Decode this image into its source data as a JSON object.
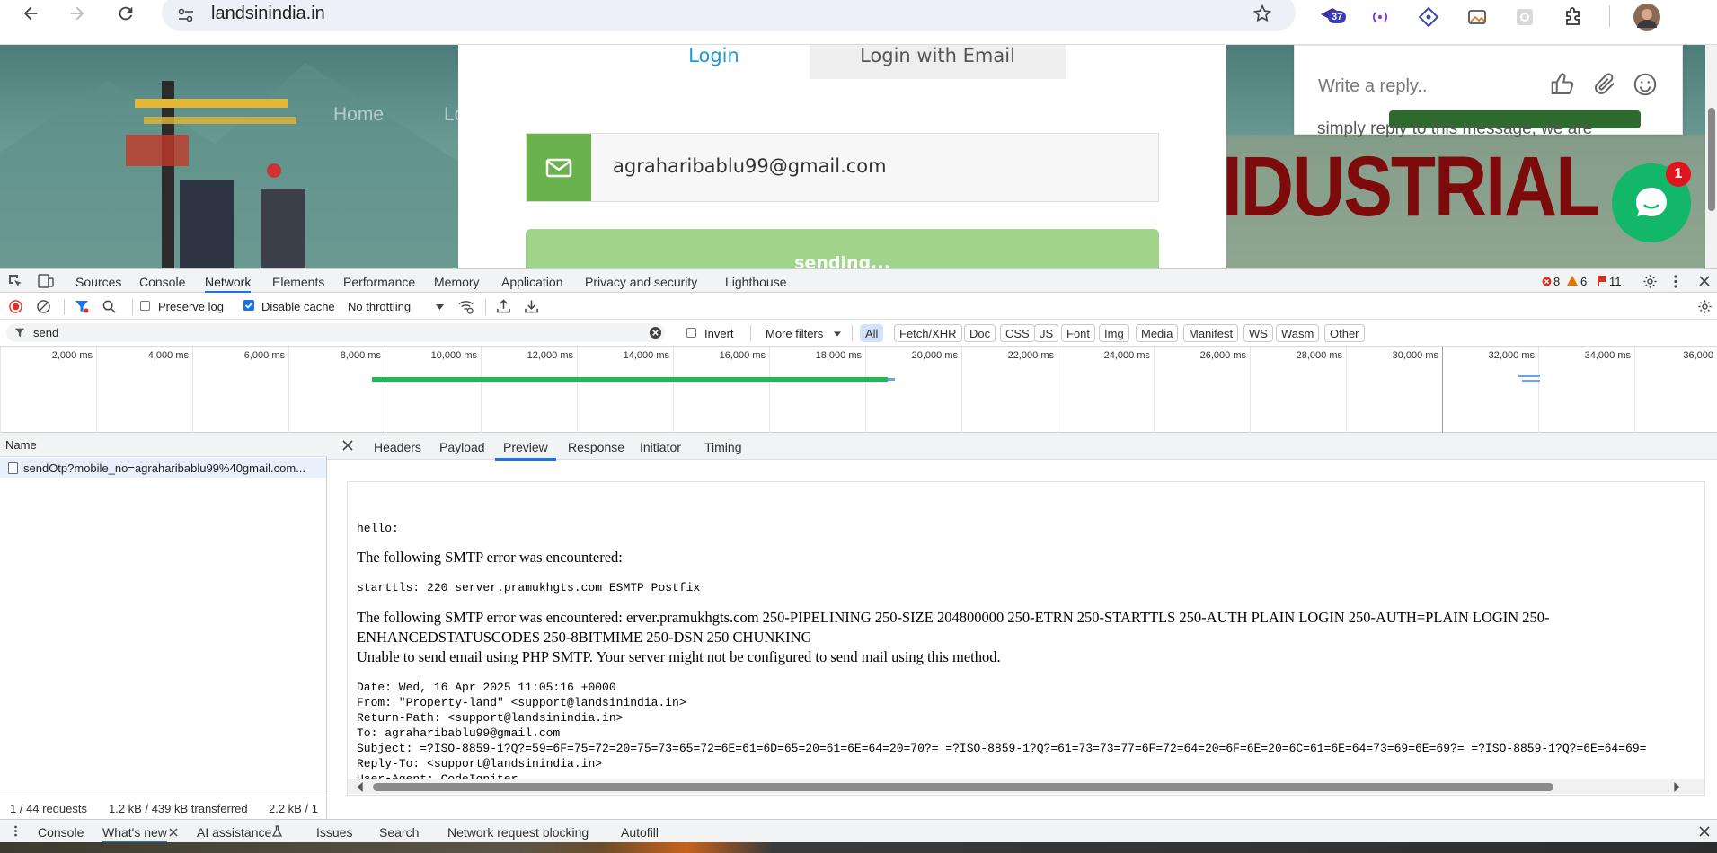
{
  "browser": {
    "url": "landsinindia.in",
    "extension_badge": "37"
  },
  "page": {
    "nav": {
      "home": "Home",
      "partial": "Lo"
    },
    "banner_text": "IDUSTRIAL",
    "login_tabs": [
      "Login",
      "Login with Email"
    ],
    "email_value": "agraharibablu99@gmail.com",
    "send_button": "sending...",
    "chat": {
      "placeholder": "Write a reply..",
      "teaser": "simply reply to this message, we are",
      "unread_count": "1"
    }
  },
  "devtools": {
    "tabs": [
      "Sources",
      "Console",
      "Network",
      "Elements",
      "Performance",
      "Memory",
      "Application",
      "Privacy and security",
      "Lighthouse"
    ],
    "active_tab": "Network",
    "counts": {
      "errors": "8",
      "warnings": "6",
      "issues": "11"
    },
    "network_bar": {
      "preserve_log": "Preserve log",
      "disable_cache": "Disable cache",
      "throttling": "No throttling"
    },
    "filter": {
      "value": "send",
      "invert": "Invert",
      "more_filters": "More filters",
      "chips": [
        "All",
        "Fetch/XHR",
        "Doc",
        "CSS",
        "JS",
        "Font",
        "Img",
        "Media",
        "Manifest",
        "WS",
        "Wasm",
        "Other"
      ]
    },
    "timeline_ticks": [
      "2,000 ms",
      "4,000 ms",
      "6,000 ms",
      "8,000 ms",
      "10,000 ms",
      "12,000 ms",
      "14,000 ms",
      "16,000 ms",
      "18,000 ms",
      "20,000 ms",
      "22,000 ms",
      "24,000 ms",
      "26,000 ms",
      "28,000 ms",
      "30,000 ms",
      "32,000 ms",
      "34,000 ms",
      "36,000"
    ],
    "name_header": "Name",
    "request_name": "sendOtp?mobile_no=agraharibablu99%40gmail.com...",
    "detail_tabs": [
      "Headers",
      "Payload",
      "Preview",
      "Response",
      "Initiator",
      "Timing"
    ],
    "active_detail_tab": "Preview",
    "preview": {
      "hello": "hello:",
      "line1": "The following SMTP error was encountered:",
      "line2": "starttls: 220 server.pramukhgts.com ESMTP Postfix",
      "line3a": "The following SMTP error was encountered: erver.pramukhgts.com 250-PIPELINING 250-SIZE 204800000 250-ETRN 250-STARTTLS 250-AUTH PLAIN LOGIN 250-AUTH=PLAIN LOGIN 250-",
      "line3b": "ENHANCEDSTATUSCODES 250-8BITMIME 250-DSN 250 CHUNKING",
      "line4": "Unable to send email using PHP SMTP. Your server might not be configured to send mail using this method.",
      "headers": [
        "Date: Wed, 16 Apr 2025 11:05:16 +0000",
        "From: \"Property-land\" <support@landsinindia.in>",
        "Return-Path: <support@landsinindia.in>",
        "To: agraharibablu99@gmail.com",
        "Subject: =?ISO-8859-1?Q?=59=6F=75=72=20=75=73=65=72=6E=61=6D=65=20=61=6E=64=20=70?= =?ISO-8859-1?Q?=61=73=73=77=6F=72=64=20=6F=6E=20=6C=61=6E=64=73=69=6E=69?= =?ISO-8859-1?Q?=6E=64=69=",
        "Reply-To: <support@landsinindia.in>",
        "User-Agent: CodeIgniter"
      ]
    },
    "status": {
      "requests": "1 / 44 requests",
      "transferred": "1.2 kB / 439 kB transferred",
      "resources": "2.2 kB / 1"
    },
    "drawer_tabs": [
      "Console",
      "What's new",
      "AI assistance",
      "Issues",
      "Search",
      "Network request blocking",
      "Autofill"
    ],
    "active_drawer_tab": "What's new"
  },
  "colors": {
    "accent": "#1a73e8",
    "email_icon_bg": "#6ab24e",
    "send_button_bg": "#9fd48a",
    "chat_green": "#12b76a",
    "timeline_bar": "#1db954"
  }
}
